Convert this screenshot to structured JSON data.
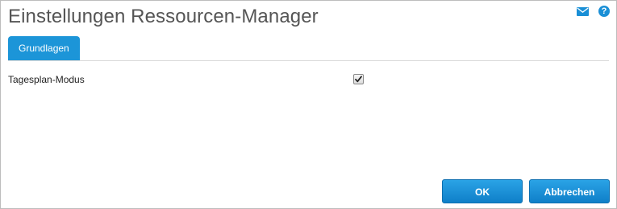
{
  "dialog": {
    "title": "Einstellungen Ressourcen-Manager"
  },
  "header_icons": [
    "mail-icon",
    "help-icon"
  ],
  "help_glyph": "?",
  "tabs": [
    {
      "label": "Grundlagen",
      "active": true
    }
  ],
  "settings": {
    "daily_plan_mode": {
      "label": "Tagesplan-Modus",
      "checked": true
    }
  },
  "footer": {
    "ok_label": "OK",
    "cancel_label": "Abbrechen"
  },
  "colors": {
    "accent": "#1c95d8",
    "title_text": "#555555"
  }
}
